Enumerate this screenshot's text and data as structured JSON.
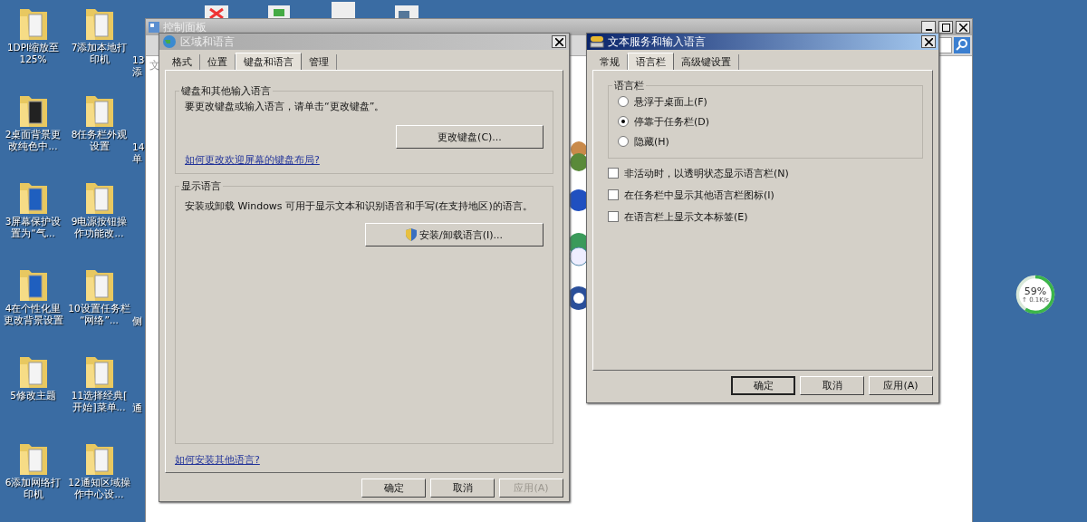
{
  "desktop": {
    "rows": [
      {
        "icons": [
          {
            "lines": [
              "1DPI缩放至",
              "125%"
            ],
            "kind": "plain"
          },
          {
            "lines": [
              "7添加本地打",
              "印机"
            ],
            "kind": "plain"
          }
        ],
        "partial_label": [
          "13",
          "添"
        ]
      },
      {
        "icons": [
          {
            "lines": [
              "2桌面背景更",
              "改纯色中..."
            ],
            "kind": "dark"
          },
          {
            "lines": [
              "8任务栏外观",
              "设置"
            ],
            "kind": "plain"
          }
        ],
        "partial_label": [
          "14",
          "单"
        ]
      },
      {
        "icons": [
          {
            "lines": [
              "3屏幕保护设",
              "置为“气..."
            ],
            "kind": "blue"
          },
          {
            "lines": [
              "9电源按钮操",
              "作功能改..."
            ],
            "kind": "plain"
          }
        ]
      },
      {
        "icons": [
          {
            "lines": [
              "4在个性化里",
              "更改背景设置"
            ],
            "kind": "blue"
          },
          {
            "lines": [
              "10设置任务栏",
              "“网络”..."
            ],
            "kind": "plain"
          }
        ],
        "partial_label": [
          "侧"
        ]
      },
      {
        "icons": [
          {
            "lines": [
              "5修改主题"
            ],
            "kind": "plain"
          },
          {
            "lines": [
              "11选择经典[",
              "开始]菜单..."
            ],
            "kind": "plain"
          }
        ],
        "partial_label": [
          "通"
        ]
      },
      {
        "icons": [
          {
            "lines": [
              "6添加网络打",
              "印机"
            ],
            "kind": "plain"
          },
          {
            "lines": [
              "12通知区域操",
              "作中心设..."
            ],
            "kind": "plain"
          }
        ]
      }
    ]
  },
  "control_panel": {
    "title": "控制面板",
    "side_text": "文"
  },
  "region_dialog": {
    "title": "区域和语言",
    "active": false,
    "tabs": [
      {
        "label": "格式",
        "selected": false
      },
      {
        "label": "位置",
        "selected": false
      },
      {
        "label": "键盘和语言",
        "selected": true
      },
      {
        "label": "管理",
        "selected": false
      }
    ],
    "keyboard_group": {
      "title": "键盘和其他输入语言",
      "text": "要更改键盘或输入语言，请单击“更改键盘”。",
      "button": "更改键盘(C)...",
      "link": "如何更改欢迎屏幕的键盘布局?"
    },
    "display_group": {
      "title": "显示语言",
      "text": "安装或卸载 Windows 可用于显示文本和识别语音和手写(在支持地区)的语言。",
      "button": "安装/卸载语言(I)..."
    },
    "footer_link": "如何安装其他语言?",
    "buttons": [
      {
        "label": "确定",
        "disabled": false
      },
      {
        "label": "取消",
        "disabled": false
      },
      {
        "label": "应用(A)",
        "disabled": true
      }
    ]
  },
  "text_services_dialog": {
    "title": "文本服务和输入语言",
    "active": true,
    "tabs": [
      {
        "label": "常规",
        "selected": false
      },
      {
        "label": "语言栏",
        "selected": true
      },
      {
        "label": "高级键设置",
        "selected": false
      }
    ],
    "group_title": "语言栏",
    "radios": [
      {
        "label": "悬浮于桌面上(F)",
        "selected": false
      },
      {
        "label": "停靠于任务栏(D)",
        "selected": true
      },
      {
        "label": "隐藏(H)",
        "selected": false
      }
    ],
    "checkboxes": [
      {
        "label": "非活动时，以透明状态显示语言栏(N)",
        "checked": false
      },
      {
        "label": "在任务栏中显示其他语言栏图标(I)",
        "checked": false
      },
      {
        "label": "在语言栏上显示文本标签(E)",
        "checked": false
      }
    ],
    "buttons": [
      {
        "label": "确定",
        "disabled": false
      },
      {
        "label": "取消",
        "disabled": false
      },
      {
        "label": "应用(A)",
        "disabled": false
      }
    ]
  },
  "speed_widget": {
    "percent": "59%",
    "rate": "↑ 0.1K/s",
    "level": 0.59
  }
}
